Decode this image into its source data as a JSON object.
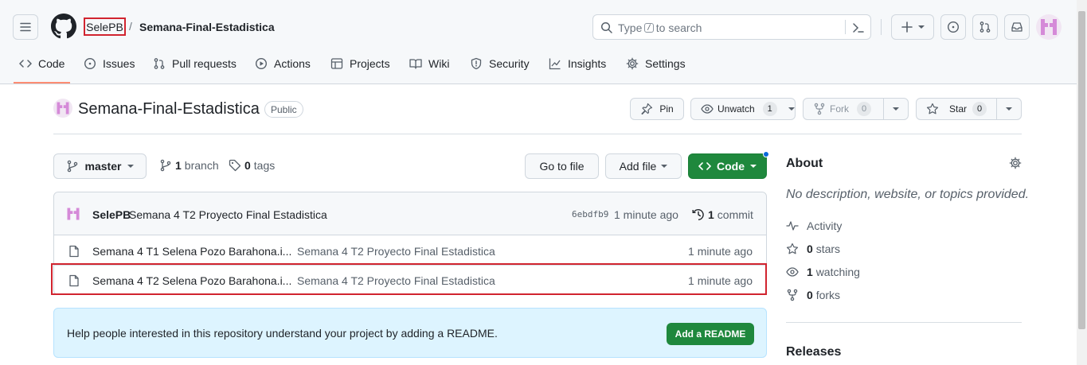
{
  "header": {
    "owner": "SelePB",
    "separator": "/",
    "repo": "Semana-Final-Estadistica",
    "search_prefix": "Type",
    "search_key": "/",
    "search_suffix": "to search"
  },
  "nav": {
    "tabs": [
      {
        "label": "Code",
        "icon": "code-icon"
      },
      {
        "label": "Issues",
        "icon": "issue-icon"
      },
      {
        "label": "Pull requests",
        "icon": "pull-request-icon"
      },
      {
        "label": "Actions",
        "icon": "play-icon"
      },
      {
        "label": "Projects",
        "icon": "table-icon"
      },
      {
        "label": "Wiki",
        "icon": "book-icon"
      },
      {
        "label": "Security",
        "icon": "shield-icon"
      },
      {
        "label": "Insights",
        "icon": "graph-icon"
      },
      {
        "label": "Settings",
        "icon": "gear-icon"
      }
    ],
    "active": "Code"
  },
  "repo_header": {
    "title": "Semana-Final-Estadistica",
    "visibility": "Public",
    "pin_label": "Pin",
    "unwatch_label": "Unwatch",
    "unwatch_count": "1",
    "fork_label": "Fork",
    "fork_count": "0",
    "star_label": "Star",
    "star_count": "0"
  },
  "toolbar": {
    "branch_name": "master",
    "branch_count": "1",
    "branch_label": "branch",
    "tag_count": "0",
    "tag_label": "tags",
    "go_to_file": "Go to file",
    "add_file": "Add file",
    "code_button": "Code"
  },
  "latest_commit": {
    "author": "SelePB",
    "message": "Semana 4 T2 Proyecto Final Estadistica",
    "sha": "6ebdfb9",
    "time": "1 minute ago",
    "commit_count": "1",
    "commit_label": "commit"
  },
  "files": [
    {
      "name": "Semana 4 T1 Selena Pozo Barahona.i...",
      "message": "Semana 4 T2 Proyecto Final Estadistica",
      "time": "1 minute ago"
    },
    {
      "name": "Semana 4 T2 Selena Pozo Barahona.i...",
      "message": "Semana 4 T2 Proyecto Final Estadistica",
      "time": "1 minute ago"
    }
  ],
  "readme_prompt": {
    "text": "Help people interested in this repository understand your project by adding a README.",
    "button": "Add a README"
  },
  "about": {
    "title": "About",
    "description": "No description, website, or topics provided.",
    "activity": "Activity",
    "stars_count": "0",
    "stars_label": "stars",
    "watching_count": "1",
    "watching_label": "watching",
    "forks_count": "0",
    "forks_label": "forks",
    "releases": "Releases"
  },
  "colors": {
    "accent_underline": "#fd8c73",
    "primary_green": "#1f883d",
    "highlight_red": "#d1242f",
    "readme_bg": "#ddf4ff"
  }
}
